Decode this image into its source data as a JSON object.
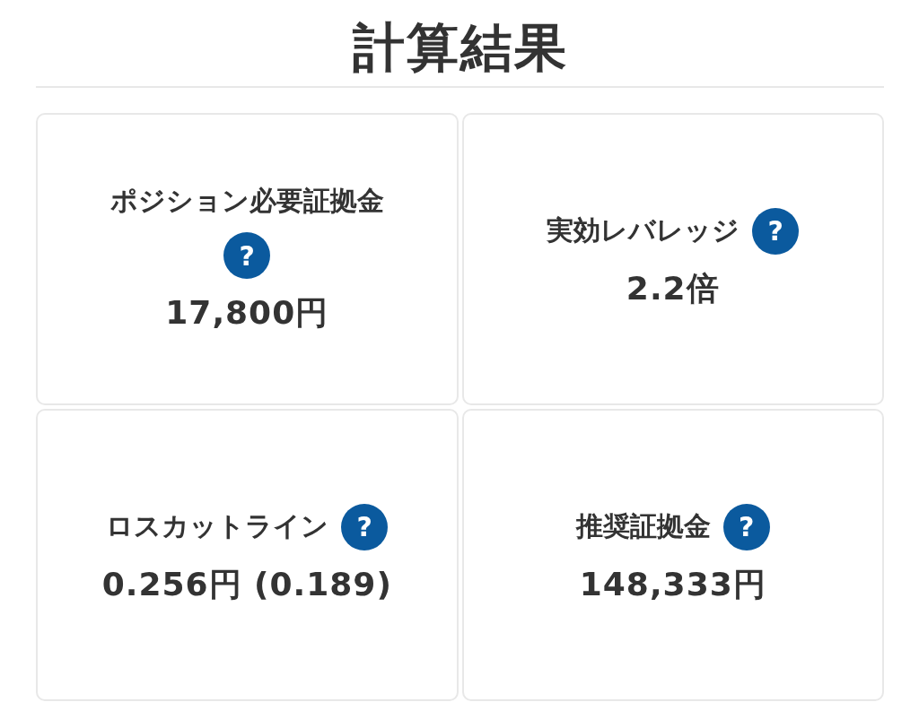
{
  "title": "計算結果",
  "cards": [
    {
      "label": "ポジション必要証拠金",
      "help": "?",
      "value": "17,800円"
    },
    {
      "label": "実効レバレッジ",
      "help": "?",
      "value": "2.2倍"
    },
    {
      "label": "ロスカットライン",
      "help": "?",
      "value": "0.256円 (0.189)"
    },
    {
      "label": "推奨証拠金",
      "help": "?",
      "value": "148,333円"
    }
  ]
}
